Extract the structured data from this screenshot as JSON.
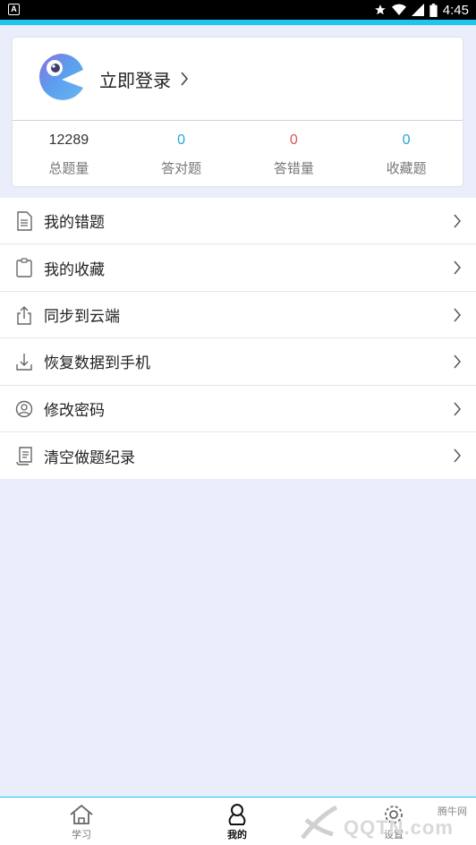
{
  "status_bar": {
    "time": "4:45",
    "app_badge": "A"
  },
  "profile": {
    "login_label": "立即登录",
    "stats": [
      {
        "value": "12289",
        "label": "总题量",
        "color": "#333333"
      },
      {
        "value": "0",
        "label": "答对题",
        "color": "#2aa4d6"
      },
      {
        "value": "0",
        "label": "答错量",
        "color": "#e05555"
      },
      {
        "value": "0",
        "label": "收藏题",
        "color": "#2aa4d6"
      }
    ]
  },
  "menu": [
    {
      "label": "我的错题",
      "icon": "document-icon"
    },
    {
      "label": "我的收藏",
      "icon": "clipboard-icon"
    },
    {
      "label": "同步到云端",
      "icon": "upload-icon"
    },
    {
      "label": "恢复数据到手机",
      "icon": "download-icon"
    },
    {
      "label": "修改密码",
      "icon": "user-circle-icon"
    },
    {
      "label": "清空做题纪录",
      "icon": "scroll-icon"
    }
  ],
  "tabs": [
    {
      "label": "学习",
      "icon": "home-icon",
      "active": false
    },
    {
      "label": "我的",
      "icon": "person-icon",
      "active": true
    },
    {
      "label": "设置",
      "icon": "gear-icon",
      "active": false
    }
  ],
  "watermark": {
    "text": "QQTN.com",
    "small": "腾牛网"
  },
  "colors": {
    "accent": "#1ec5ee",
    "background": "#eaedfa",
    "correct": "#2aa4d6",
    "wrong": "#e05555"
  }
}
